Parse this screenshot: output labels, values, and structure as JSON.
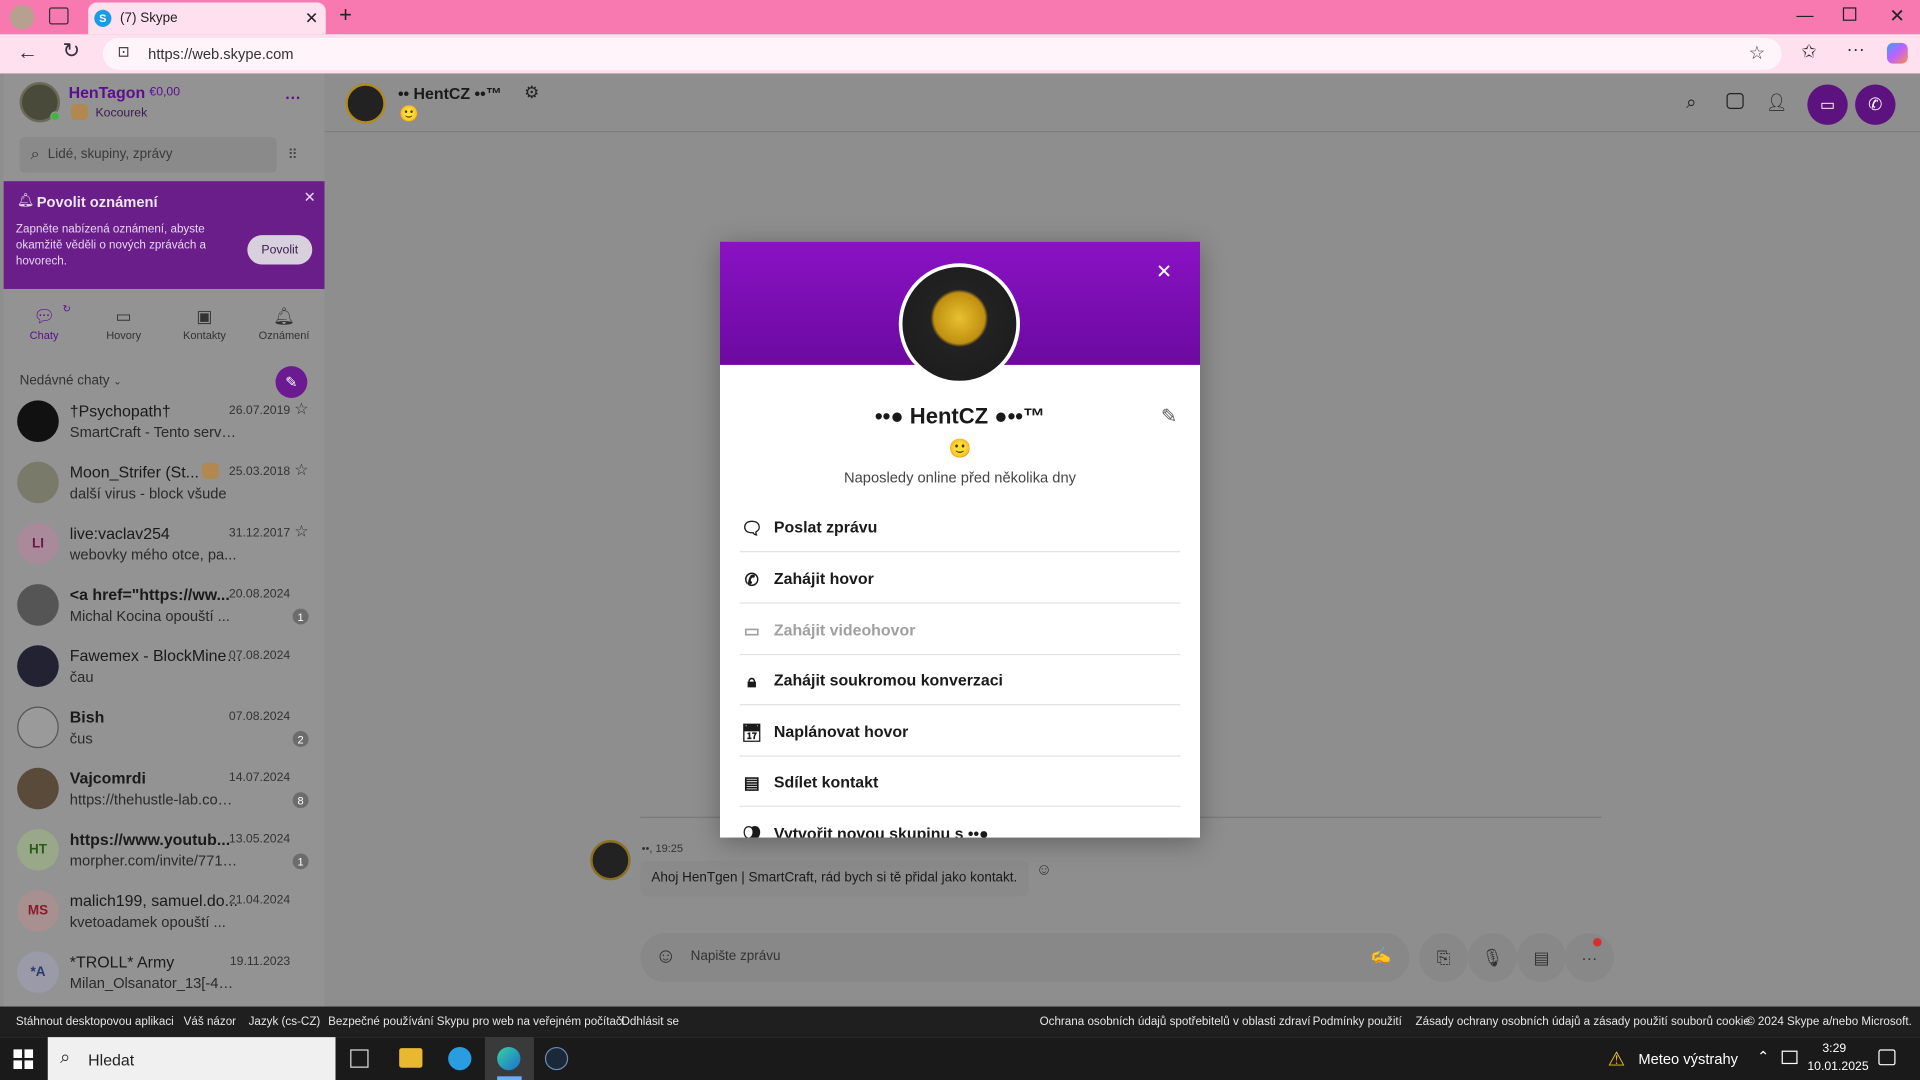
{
  "browser": {
    "tab_title": "(7) Skype",
    "url": "https://web.skype.com",
    "new_tab": "+"
  },
  "profile": {
    "name": "HenTagon",
    "balance": "€0,00",
    "mood": "Kocourek",
    "more": "···"
  },
  "search": {
    "placeholder": "Lidé, skupiny, zprávy"
  },
  "notification_banner": {
    "title": "Povolit oznámení",
    "text": "Zapněte nabízená oznámení, abyste okamžitě věděli o nových zprávách a hovorech.",
    "button": "Povolit"
  },
  "nav": [
    {
      "label": "Chaty",
      "icon": "chat-icon"
    },
    {
      "label": "Hovory",
      "icon": "video-icon"
    },
    {
      "label": "Kontakty",
      "icon": "contacts-icon"
    },
    {
      "label": "Oznámení",
      "icon": "bell-icon"
    }
  ],
  "recent_label": "Nedávné chaty",
  "chats": [
    {
      "name": "†Psychopath†",
      "date": "26.07.2019",
      "preview": "SmartCraft - Tento serve...",
      "initials": "",
      "badge": ""
    },
    {
      "name": "Moon_Strifer (St...",
      "date": "25.03.2018",
      "preview": "další virus - block všude",
      "initials": "",
      "badge": ""
    },
    {
      "name": "live:vaclav254",
      "date": "31.12.2017",
      "preview": "webovky mého otce, pa...",
      "initials": "LI",
      "badge": ""
    },
    {
      "name": "<a href=\"https://ww...",
      "date": "20.08.2024",
      "preview": "Michal Kocina opouští ...",
      "initials": "",
      "badge": "1"
    },
    {
      "name": "Fawemex - BlockMine ...",
      "date": "07.08.2024",
      "preview": "čau",
      "initials": "",
      "badge": ""
    },
    {
      "name": "Bish",
      "date": "07.08.2024",
      "preview": "čus",
      "initials": "",
      "badge": "2"
    },
    {
      "name": "Vajcomrdi",
      "date": "14.07.2024",
      "preview": "https://thehustle-lab.com/?...",
      "initials": "",
      "badge": "8"
    },
    {
      "name": "https://www.youtub...",
      "date": "13.05.2024",
      "preview": "morpher.com/invite/77161...",
      "initials": "HT",
      "badge": "1"
    },
    {
      "name": "malich199, samuel.do...",
      "date": "21.04.2024",
      "preview": "kvetoadamek opouští ...",
      "initials": "MS",
      "badge": ""
    },
    {
      "name": "*TROLL* Army",
      "date": "19.11.2023",
      "preview": "Milan_Olsanator_13[-4TB-]",
      "initials": "*A",
      "badge": ""
    }
  ],
  "conversation": {
    "title": "•• HentCZ ••™",
    "mood_emoji": "🙂",
    "message_sender": "••, 19:25",
    "message_text": "Ahoj HenTgen | SmartCraft, rád bych si tě přidal jako kontakt.",
    "compose_placeholder": "Napište zprávu"
  },
  "modal": {
    "name": "••● HentCZ ●••™",
    "emoji": "🙂",
    "status": "Naposledy online před několika dny",
    "actions": [
      {
        "label": "Poslat zprávu",
        "icon": "message-icon",
        "disabled": false
      },
      {
        "label": "Zahájit hovor",
        "icon": "phone-icon",
        "disabled": false
      },
      {
        "label": "Zahájit videohovor",
        "icon": "video-icon",
        "disabled": true
      },
      {
        "label": "Zahájit soukromou konverzaci",
        "icon": "lock-chat-icon",
        "disabled": false
      },
      {
        "label": "Naplánovat hovor",
        "icon": "calendar-icon",
        "disabled": false
      },
      {
        "label": "Sdílet kontakt",
        "icon": "contact-card-icon",
        "disabled": false
      },
      {
        "label": "Vytvořit novou skupinu s ••●",
        "icon": "group-icon",
        "disabled": false
      }
    ]
  },
  "footer": {
    "left": [
      "Stáhnout desktopovou aplikaci",
      "Váš názor",
      "Jazyk (cs-CZ)",
      "Bezpečné používání Skypu pro web na veřejném počítači",
      "Odhlásit se"
    ],
    "right": [
      "Ochrana osobních údajů spotřebitelů v oblasti zdraví",
      "Podmínky použití",
      "Zásady ochrany osobních údajů a zásady použití souborů cookie",
      "© 2024 Skype a/nebo Microsoft."
    ]
  },
  "taskbar": {
    "search": "Hledat",
    "weather": "Meteo výstrahy",
    "time": "3:29",
    "date": "10.01.2025"
  },
  "colors": {
    "accent": "#7a10b6",
    "tab_bar": "#f878b0"
  }
}
